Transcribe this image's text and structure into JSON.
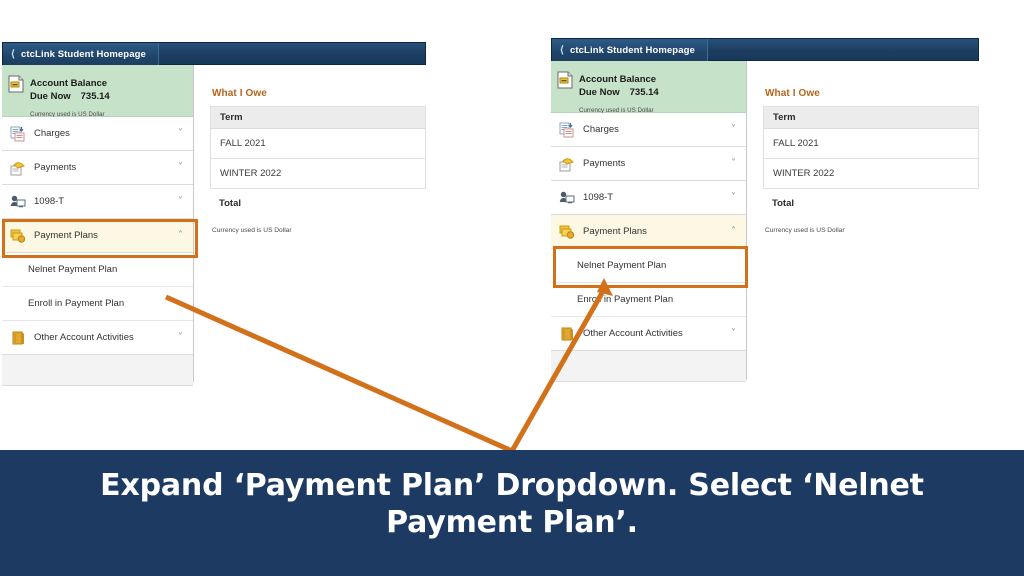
{
  "caption": {
    "text": "Expand ‘Payment Plan’ Dropdown. Select ‘Nelnet Payment Plan’."
  },
  "colors": {
    "header_blue": "#1d3e60",
    "caption_blue": "#1d3a63",
    "highlight_orange": "#d2711a",
    "account_green": "#c6e3ca",
    "title_orange": "#b5651d",
    "highlight_row_yellow": "#fdf8e3"
  },
  "screenshots": [
    {
      "id": "left",
      "header": {
        "back_label": "ctcLink Student Homepage",
        "back_icon": "chevron-left-icon"
      },
      "account_balance": {
        "icon": "account-balance-icon",
        "title": "Account Balance",
        "due_label": "Due Now",
        "due_amount": "735.14",
        "currency_note": "Currency used is US Dollar"
      },
      "nav": [
        {
          "label": "Charges",
          "icon": "charges-icon",
          "caret": "chevron-down-icon",
          "expanded": false,
          "highlight": false
        },
        {
          "label": "Payments",
          "icon": "payments-icon",
          "caret": "chevron-down-icon",
          "expanded": false,
          "highlight": false
        },
        {
          "label": "1098-T",
          "icon": "1098t-icon",
          "caret": "chevron-down-icon",
          "expanded": false,
          "highlight": false
        },
        {
          "label": "Payment Plans",
          "icon": "payment-plans-icon",
          "caret": "chevron-up-icon",
          "expanded": true,
          "highlight": true
        },
        {
          "label": "Other Account Activities",
          "icon": "other-activities-icon",
          "caret": "chevron-down-icon",
          "expanded": false,
          "highlight": false
        }
      ],
      "sub_items": [
        {
          "label": "Nelnet Payment Plan",
          "highlight": false
        },
        {
          "label": "Enroll in Payment Plan",
          "highlight": false
        }
      ],
      "pane": {
        "title": "What I Owe",
        "columns": [
          "Term"
        ],
        "rows": [
          [
            "FALL 2021"
          ],
          [
            "WINTER 2022"
          ]
        ],
        "total_label": "Total",
        "currency_note": "Currency used is US Dollar"
      }
    },
    {
      "id": "right",
      "header": {
        "back_label": "ctcLink Student Homepage",
        "back_icon": "chevron-left-icon"
      },
      "account_balance": {
        "icon": "account-balance-icon",
        "title": "Account Balance",
        "due_label": "Due Now",
        "due_amount": "735.14",
        "currency_note": "Currency used is US Dollar"
      },
      "nav": [
        {
          "label": "Charges",
          "icon": "charges-icon",
          "caret": "chevron-down-icon",
          "expanded": false,
          "highlight": false
        },
        {
          "label": "Payments",
          "icon": "payments-icon",
          "caret": "chevron-down-icon",
          "expanded": false,
          "highlight": false
        },
        {
          "label": "1098-T",
          "icon": "1098t-icon",
          "caret": "chevron-down-icon",
          "expanded": false,
          "highlight": false
        },
        {
          "label": "Payment Plans",
          "icon": "payment-plans-icon",
          "caret": "chevron-up-icon",
          "expanded": true,
          "highlight": true
        },
        {
          "label": "Other Account Activities",
          "icon": "other-activities-icon",
          "caret": "chevron-down-icon",
          "expanded": false,
          "highlight": false
        }
      ],
      "sub_items": [
        {
          "label": "Nelnet Payment Plan",
          "highlight": true
        },
        {
          "label": "Enroll in Payment Plan",
          "highlight": false
        }
      ],
      "pane": {
        "title": "What I Owe",
        "columns": [
          "Term"
        ],
        "rows": [
          [
            "FALL 2021"
          ],
          [
            "WINTER 2022"
          ]
        ],
        "total_label": "Total",
        "currency_note": "Currency used is US Dollar"
      }
    }
  ]
}
